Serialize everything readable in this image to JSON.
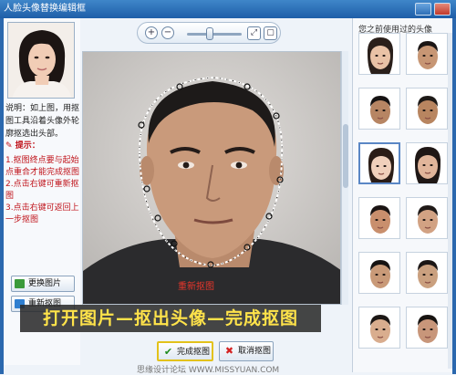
{
  "window": {
    "title": "人脸头像替换编辑框"
  },
  "left": {
    "instruction": "说明：如上图，用抠图工具沿着头像外轮廓抠选出头部。",
    "tips_title": "提示：",
    "tips": [
      "1.抠图终点要与起始点重合才能完成抠图",
      "2.点击右键可重新抠图",
      "3.点击右键可返回上一步抠图"
    ],
    "change_image_label": "更换图片",
    "redraw_label": "重新抠图"
  },
  "toolbar": {
    "zoom_in": "+",
    "zoom_out": "−",
    "slider_value": 0.5
  },
  "canvas": {
    "redraw_hint": "重新抠图"
  },
  "caption": "打开图片—抠出头像—完成抠图",
  "buttons": {
    "done": "完成抠图",
    "cancel": "取消抠图"
  },
  "right": {
    "title": "您之前使用过的头像",
    "thumbnails": 12
  },
  "watermark": "思缘设计论坛 WWW.MISSYUAN.COM",
  "colors": {
    "title_bar": "#1e5ea8",
    "tips_red": "#c0141b",
    "caption_yellow": "#ffe34a",
    "highlight": "#e3c21a"
  }
}
